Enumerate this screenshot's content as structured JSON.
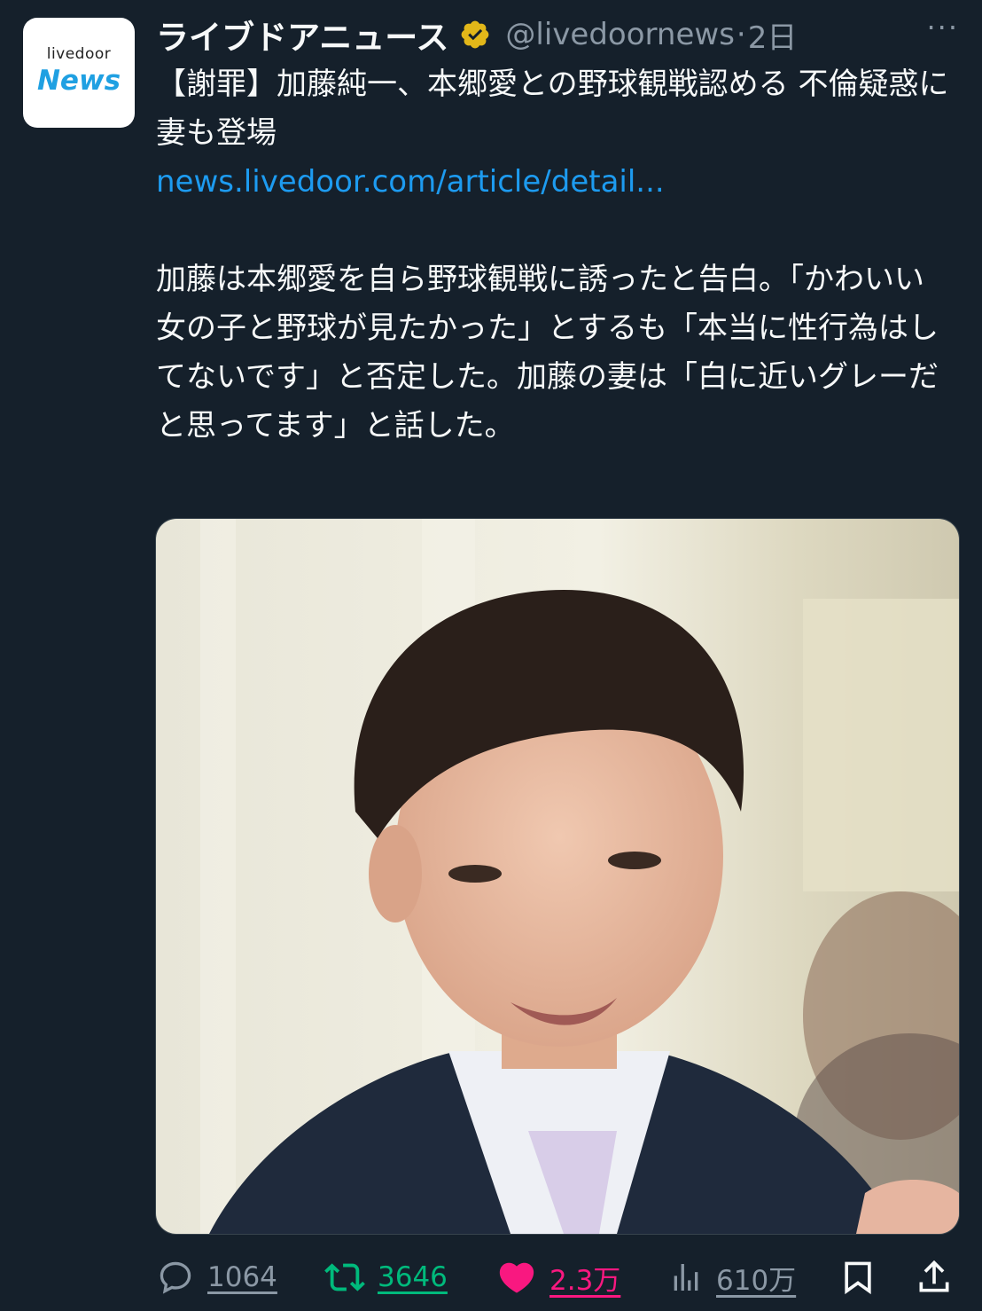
{
  "author": {
    "avatar_line1": "livedoor",
    "avatar_line2": "News",
    "name": "ライブドアニュース",
    "handle": "@livedoornews",
    "separator": "·",
    "time": "2日",
    "verified_icon": "verified-badge-icon",
    "badge_color": "#e2b719"
  },
  "more_label": "···",
  "tweet": {
    "title": "【謝罪】加藤純一、本郷愛との野球観戦認める 不倫疑惑に妻も登場",
    "link": "news.livedoor.com/article/detail...",
    "body": "加藤は本郷愛を自ら野球観戦に誘ったと告白。「かわいい女の子と野球が見たかった」とするも「本当に性行為はしてないです」と否定した。加藤の妻は「白に近いグレーだと思ってます」と話した。"
  },
  "actions": {
    "reply_count": "1064",
    "retweet_count": "3646",
    "like_count": "2.3万",
    "views_count": "610万"
  },
  "colors": {
    "background": "#15202b",
    "text": "#f7f9f9",
    "muted": "#8b98a5",
    "link": "#1d9bf0",
    "retweet": "#00ba7c",
    "like": "#f91880"
  }
}
